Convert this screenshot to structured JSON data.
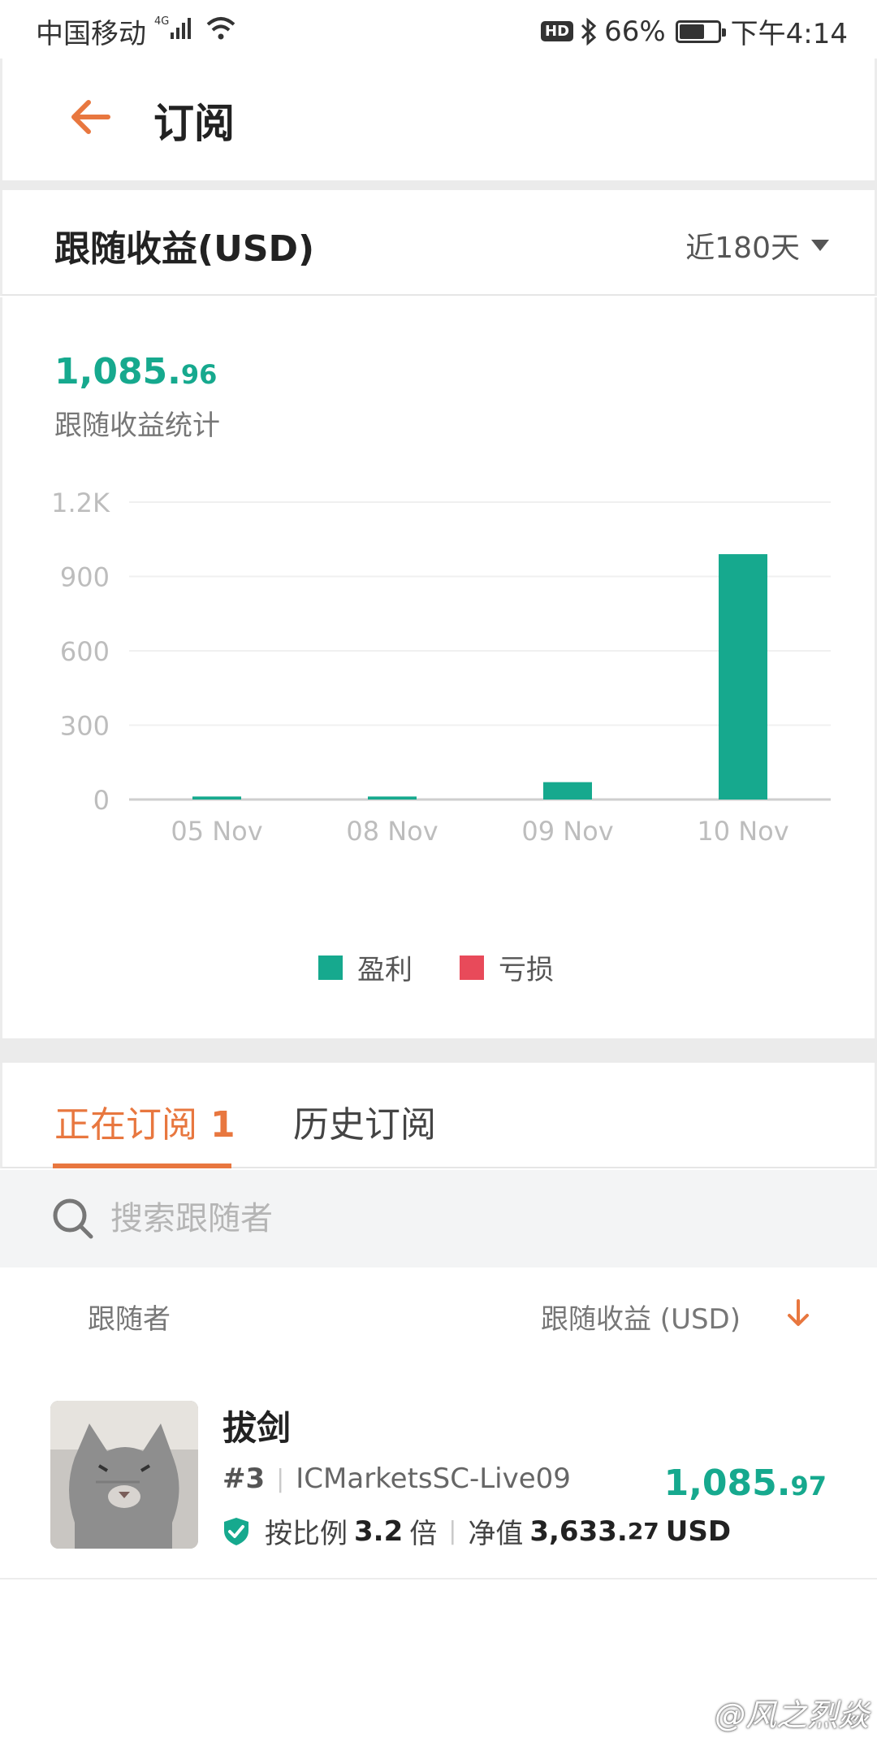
{
  "status_bar": {
    "carrier": "中国移动",
    "network": "4G",
    "hd": "HD",
    "battery_text": "66%",
    "battery_level": 0.66,
    "time": "下午4:14"
  },
  "header": {
    "back_icon": "arrow-left-icon",
    "title": "订阅"
  },
  "earnings": {
    "title": "跟随收益(USD)",
    "range_label": "近180天",
    "total_int": "1,085.",
    "total_dec": "96",
    "total_label": "跟随收益统计"
  },
  "chart_data": {
    "type": "bar",
    "categories": [
      "05 Nov",
      "08 Nov",
      "09 Nov",
      "10 Nov"
    ],
    "series": [
      {
        "name": "盈利",
        "values": [
          12,
          12,
          70,
          990
        ],
        "color": "#16a98e"
      },
      {
        "name": "亏损",
        "values": [
          0,
          0,
          0,
          0
        ],
        "color": "#e84a5a"
      }
    ],
    "y_ticks": [
      "0",
      "300",
      "600",
      "900",
      "1.2K"
    ],
    "ylim": [
      0,
      1200
    ],
    "grid": true,
    "legend_position": "bottom-center"
  },
  "tabs": [
    {
      "label": "正在订阅",
      "count": "1",
      "active": true
    },
    {
      "label": "历史订阅",
      "count": "",
      "active": false
    }
  ],
  "search": {
    "placeholder": "搜索跟随者"
  },
  "columns": {
    "follower": "跟随者",
    "earnings": "跟随收益 (USD)"
  },
  "followers": [
    {
      "name": "拔剑",
      "rank": "#3",
      "server": "ICMarketsSC-Live09",
      "value_int": "1,085.",
      "value_dec": "97",
      "ratio_prefix": "按比例",
      "ratio": "3.2",
      "ratio_suffix": "倍",
      "equity_label": "净值",
      "equity_int": "3,633.",
      "equity_dec": "27",
      "equity_unit": "USD"
    }
  ],
  "watermark": "@风之烈焱"
}
